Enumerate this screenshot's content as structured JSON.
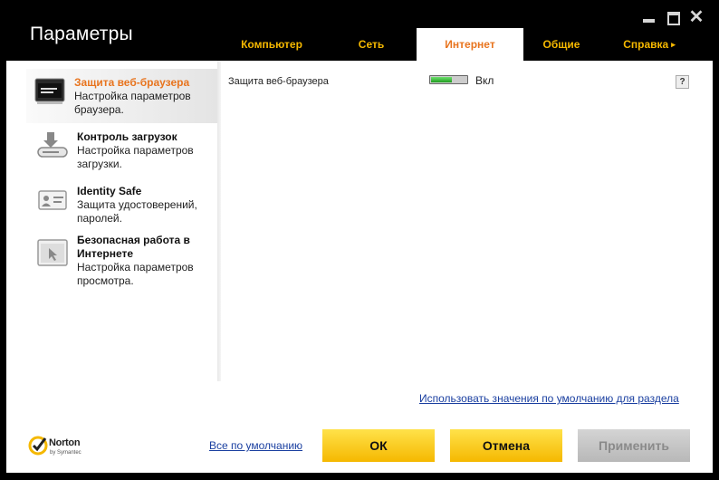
{
  "window": {
    "title": "Параметры"
  },
  "tabs": [
    {
      "label": "Компьютер"
    },
    {
      "label": "Сеть"
    },
    {
      "label": "Интернет"
    },
    {
      "label": "Общие"
    },
    {
      "label": "Справка",
      "arrow": "▸"
    }
  ],
  "sidebar": {
    "items": [
      {
        "title": "Защита веб-браузера",
        "desc": "Настройка параметров браузера.",
        "icon": "browser-protection-icon",
        "active": true
      },
      {
        "title": "Контроль загрузок",
        "desc": "Настройка параметров загрузки.",
        "icon": "download-icon",
        "active": false
      },
      {
        "title": "Identity Safe",
        "desc": "Защита удостоверений, паролей.",
        "icon": "id-card-icon",
        "active": false
      },
      {
        "title": "Безопасная работа в Интернете",
        "desc": "Настройка параметров просмотра.",
        "icon": "safe-browsing-icon",
        "active": false
      }
    ]
  },
  "main": {
    "setting": {
      "label": "Защита веб-браузера",
      "state": "Вкл",
      "level": 0.6
    },
    "help": "?",
    "reset_section": "Использовать значения по умолчанию для раздела"
  },
  "footer": {
    "logo_text": "Norton",
    "logo_sub": "by Symantec",
    "reset_all": "Все по умолчанию",
    "ok": "ОК",
    "cancel": "Отмена",
    "apply": "Применить"
  },
  "colors": {
    "accent": "#f5b800",
    "active_tab_text": "#e8741e",
    "link": "#1a3fa0",
    "toggle_on": "#1f9c1f"
  }
}
